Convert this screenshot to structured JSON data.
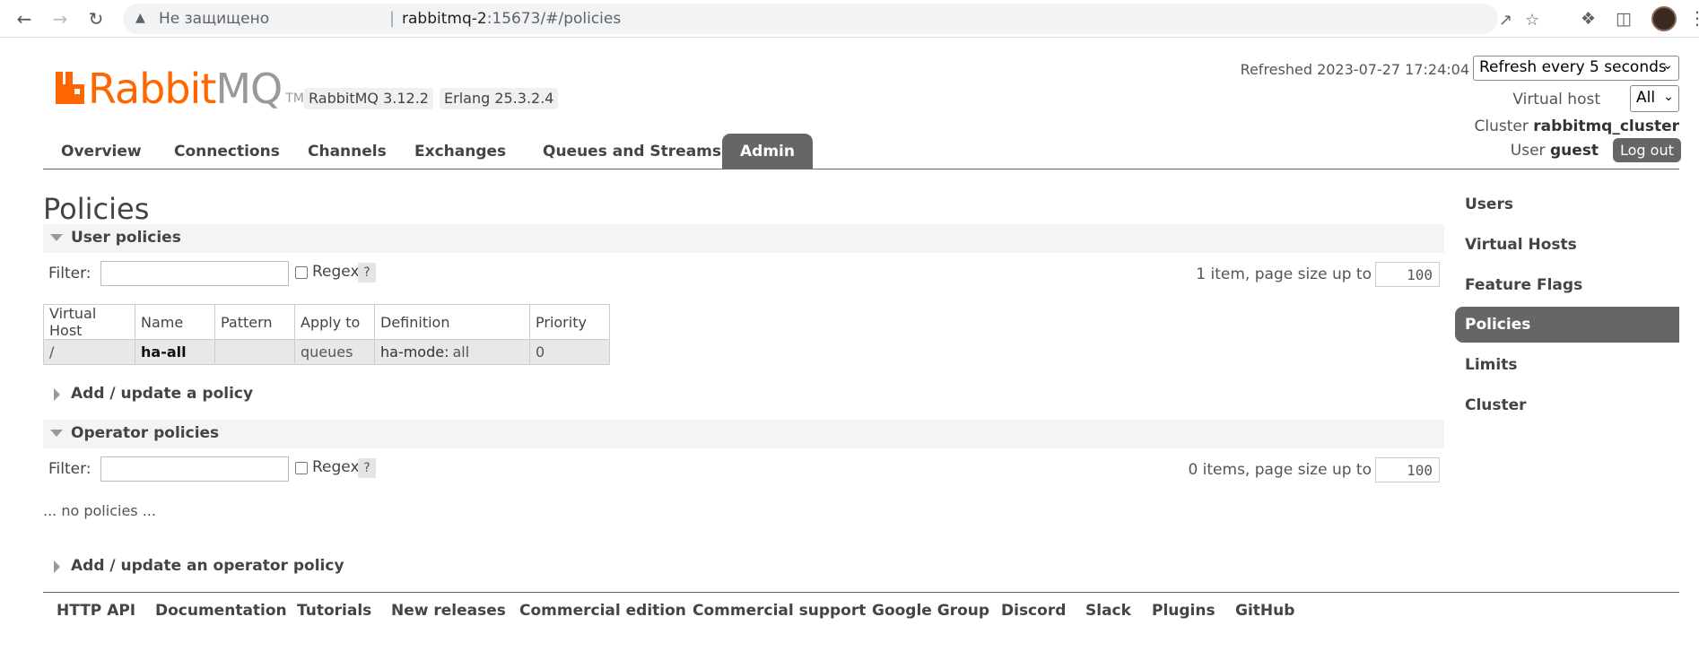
{
  "browser": {
    "security_label": "Не защищено",
    "url_host": "rabbitmq-2",
    "url_rest": ":15673/#/policies"
  },
  "header": {
    "logo_text_main": "Rabbit",
    "logo_text_mq": "MQ",
    "logo_tm": "TM",
    "rabbitmq_version": "RabbitMQ 3.12.2",
    "erlang_version": "Erlang 25.3.2.4",
    "refreshed_label": "Refreshed 2023-07-27 17:24:04",
    "refresh_select": "Refresh every 5 seconds",
    "virtual_host_label": "Virtual host",
    "virtual_host_value": "All",
    "cluster_label": "Cluster",
    "cluster_name": "rabbitmq_cluster",
    "user_label": "User",
    "user_name": "guest",
    "logout_label": "Log out"
  },
  "tabs": [
    {
      "label": "Overview"
    },
    {
      "label": "Connections"
    },
    {
      "label": "Channels"
    },
    {
      "label": "Exchanges"
    },
    {
      "label": "Queues and Streams"
    },
    {
      "label": "Admin",
      "active": true
    }
  ],
  "page": {
    "title": "Policies",
    "user_policies": {
      "section_label": "User policies",
      "filter_label": "Filter:",
      "filter_value": "",
      "regex_label": "Regex",
      "help_label": "?",
      "count_label": "1 item, page size up to",
      "page_size": "100",
      "columns": [
        "Virtual Host",
        "Name",
        "Pattern",
        "Apply to",
        "Definition",
        "Priority"
      ],
      "rows": [
        {
          "vhost": "/",
          "name": "ha-all",
          "pattern": "",
          "apply_to": "queues",
          "def_key": "ha-mode:",
          "def_value": "all",
          "priority": "0"
        }
      ]
    },
    "add_policy_label": "Add / update a policy",
    "operator_policies": {
      "section_label": "Operator policies",
      "filter_label": "Filter:",
      "filter_value": "",
      "regex_label": "Regex",
      "help_label": "?",
      "count_label": "0 items, page size up to",
      "page_size": "100",
      "empty_label": "... no policies ..."
    },
    "add_operator_policy_label": "Add / update an operator policy"
  },
  "sidebar": {
    "items": [
      {
        "label": "Users"
      },
      {
        "label": "Virtual Hosts"
      },
      {
        "label": "Feature Flags"
      },
      {
        "label": "Policies",
        "active": true
      },
      {
        "label": "Limits"
      },
      {
        "label": "Cluster"
      }
    ]
  },
  "footer": {
    "links": [
      "HTTP API",
      "Documentation",
      "Tutorials",
      "New releases",
      "Commercial edition",
      "Commercial support",
      "Google Group",
      "Discord",
      "Slack",
      "Plugins",
      "GitHub"
    ]
  },
  "colors": {
    "brand_orange": "#ff6600",
    "tab_active_bg": "#666666"
  }
}
